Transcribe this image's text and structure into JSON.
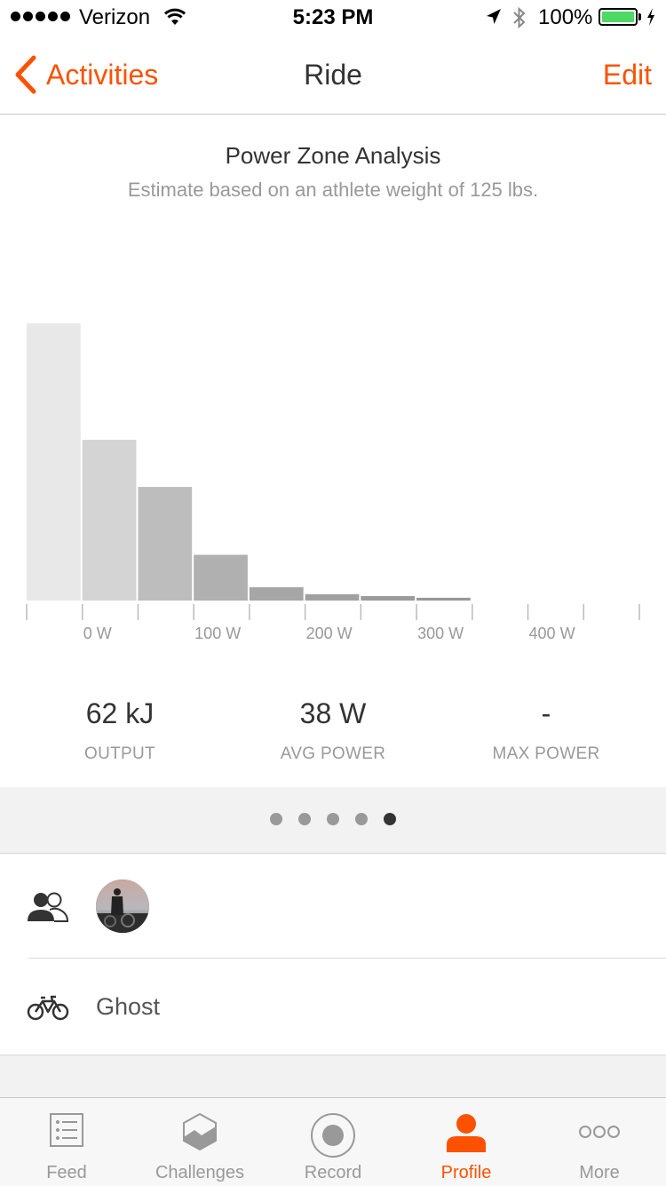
{
  "status_bar": {
    "carrier": "Verizon",
    "time": "5:23 PM",
    "battery": "100%"
  },
  "nav": {
    "back_label": "Activities",
    "title": "Ride",
    "edit_label": "Edit"
  },
  "chart": {
    "title": "Power Zone Analysis",
    "subtitle": "Estimate based on an athlete weight of 125 lbs."
  },
  "chart_data": {
    "type": "bar",
    "title": "Power Zone Analysis",
    "subtitle": "Estimate based on an athlete weight of 125 lbs.",
    "bin_width_w": 50,
    "bins_start_w": [
      -50,
      0,
      50,
      100,
      150,
      200,
      250,
      300,
      350,
      400,
      450
    ],
    "values": [
      100,
      58,
      41,
      16.5,
      4.8,
      2.3,
      1.6,
      1.0,
      0,
      0,
      0
    ],
    "value_unit": "relative share (tallest bar = 100)",
    "x_tick_labels": [
      "0 W",
      "100 W",
      "200 W",
      "300 W",
      "400 W"
    ],
    "x_tick_values": [
      0,
      100,
      200,
      300,
      400
    ],
    "xlim": [
      -50,
      500
    ],
    "grid": false,
    "colors": [
      "#e8e8e8",
      "#d4d4d4",
      "#bdbdbd",
      "#b0b0b0",
      "#a6a6a6",
      "#a0a0a0",
      "#9b9b9b",
      "#979797"
    ]
  },
  "stats": [
    {
      "value": "62 kJ",
      "label": "OUTPUT"
    },
    {
      "value": "38 W",
      "label": "AVG POWER"
    },
    {
      "value": "-",
      "label": "MAX POWER"
    }
  ],
  "pager": {
    "count": 5,
    "active_index": 4
  },
  "bike": {
    "name": "Ghost"
  },
  "tabs": [
    {
      "label": "Feed",
      "icon": "feed-icon"
    },
    {
      "label": "Challenges",
      "icon": "challenges-icon"
    },
    {
      "label": "Record",
      "icon": "record-icon"
    },
    {
      "label": "Profile",
      "icon": "profile-icon",
      "active": true
    },
    {
      "label": "More",
      "icon": "more-icon"
    }
  ],
  "colors": {
    "accent": "#fc5200",
    "battery": "#4cd964",
    "section_bg": "#f2f2f2"
  }
}
